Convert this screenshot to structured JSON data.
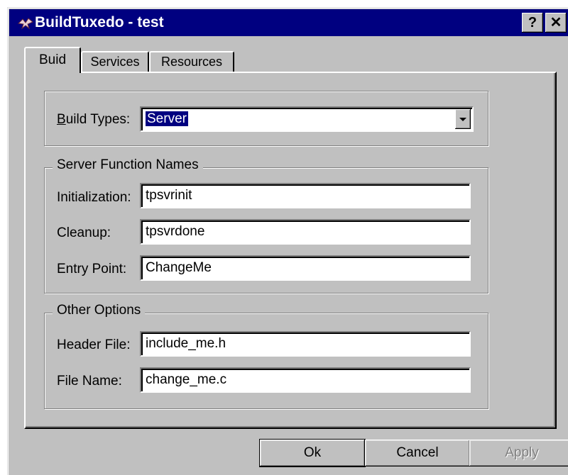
{
  "window": {
    "title": "BuildTuxedo - test",
    "help_button": "?",
    "close_button": "✕"
  },
  "tabs": [
    {
      "label": "Buid",
      "active": true
    },
    {
      "label": "Services",
      "active": false
    },
    {
      "label": "Resources",
      "active": false
    }
  ],
  "build_type": {
    "label": "Build Types:",
    "value": "Server"
  },
  "server_functions": {
    "title": "Server Function Names",
    "initialization": {
      "label": "Initialization:",
      "value": "tpsvrinit"
    },
    "cleanup": {
      "label": "Cleanup:",
      "value": "tpsvrdone"
    },
    "entry_point": {
      "label": "Entry Point:",
      "value": "ChangeMe"
    }
  },
  "other_options": {
    "title": "Other Options",
    "header_file": {
      "label": "Header File:",
      "value": "include_me.h"
    },
    "file_name": {
      "label": "File Name:",
      "value": "change_me.c"
    }
  },
  "buttons": {
    "ok": "Ok",
    "cancel": "Cancel",
    "apply": "Apply"
  },
  "colors": {
    "titlebar": "#000080",
    "face": "#c0c0c0",
    "selection": "#000080"
  },
  "icons": {
    "app": "bird-app-icon",
    "combo": "dropdown-arrow-icon"
  }
}
